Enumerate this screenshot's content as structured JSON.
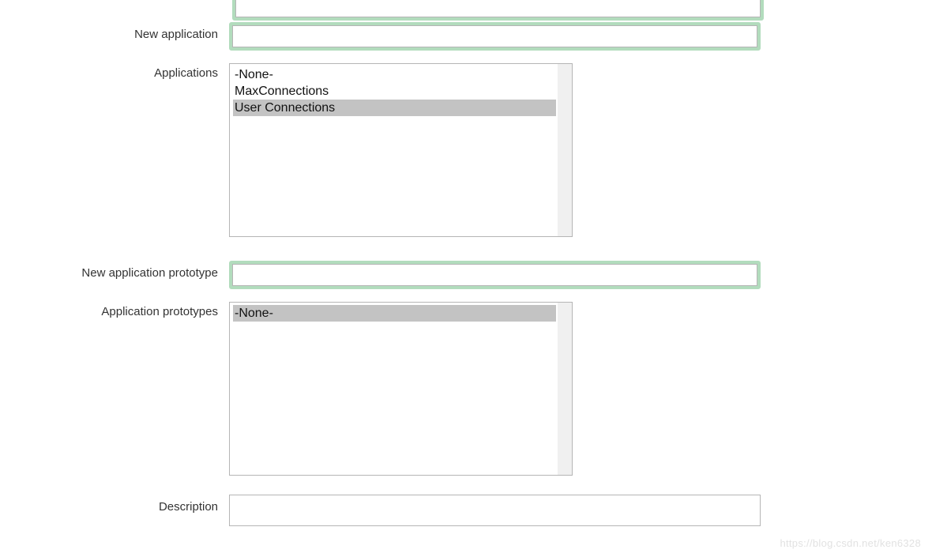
{
  "labels": {
    "new_application": "New application",
    "applications": "Applications",
    "new_application_prototype": "New application prototype",
    "application_prototypes": "Application prototypes",
    "description": "Description"
  },
  "inputs": {
    "new_application": "",
    "new_application_prototype": "",
    "description": ""
  },
  "applications_list": {
    "items": [
      {
        "label": "-None-",
        "selected": false
      },
      {
        "label": "MaxConnections",
        "selected": false
      },
      {
        "label": "User Connections",
        "selected": true
      }
    ]
  },
  "application_prototypes_list": {
    "items": [
      {
        "label": "-None-",
        "selected": true
      }
    ]
  },
  "watermark": "https://blog.csdn.net/ken6328"
}
